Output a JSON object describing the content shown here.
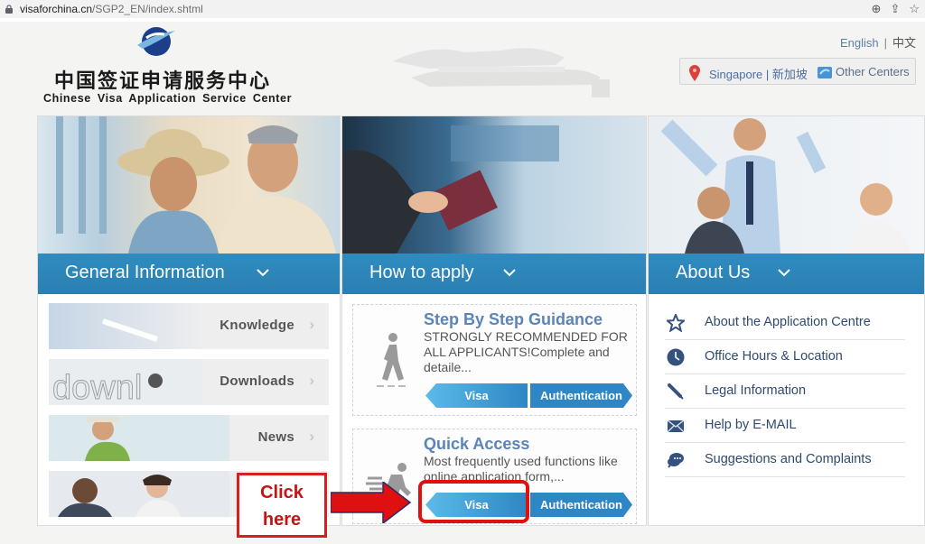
{
  "browser": {
    "url_host": "visaforchina.cn",
    "url_path": "/SGP2_EN/index.shtml",
    "tools": [
      "zoom-icon",
      "share-icon",
      "star-icon"
    ]
  },
  "header": {
    "logo_cn": "中国签证申请服务中心",
    "logo_en": "Chinese Visa Application Service Center",
    "lang_english": "English",
    "lang_sep": "|",
    "lang_chinese": "中文",
    "current_center": "Singapore | 新加坡",
    "other_centers": "Other Centers"
  },
  "general_info": {
    "banner": "General Information",
    "items": [
      {
        "label": "Knowledge"
      },
      {
        "label": "Downloads"
      },
      {
        "label": "News"
      },
      {
        "label": ""
      }
    ]
  },
  "how_to_apply": {
    "banner": "How to apply",
    "cards": [
      {
        "title": "Step By Step Guidance",
        "desc": "STRONGLY RECOMMENDED FOR ALL APPLICANTS!Complete and detaile...",
        "visa_label": "Visa",
        "auth_label": "Authentication"
      },
      {
        "title": "Quick Access",
        "desc": "Most frequently used functions like online application form,...",
        "visa_label": "Visa",
        "auth_label": "Authentication"
      }
    ]
  },
  "about_us": {
    "banner": "About Us",
    "items": [
      {
        "label": "About the Application Centre",
        "icon": "star-icon"
      },
      {
        "label": "Office Hours & Location",
        "icon": "clock-icon"
      },
      {
        "label": "Legal Information",
        "icon": "pen-icon"
      },
      {
        "label": "Help by E-MAIL",
        "icon": "mail-icon"
      },
      {
        "label": "Suggestions and Complaints",
        "icon": "chat-icon"
      }
    ]
  },
  "annotation": {
    "callout_line1": "Click",
    "callout_line2": "here"
  },
  "colors": {
    "banner_blue": "#2f8cc0",
    "title_blue": "#5b84b8",
    "link_blue": "#2f4a6e",
    "annotation_red": "#d81f1f"
  }
}
